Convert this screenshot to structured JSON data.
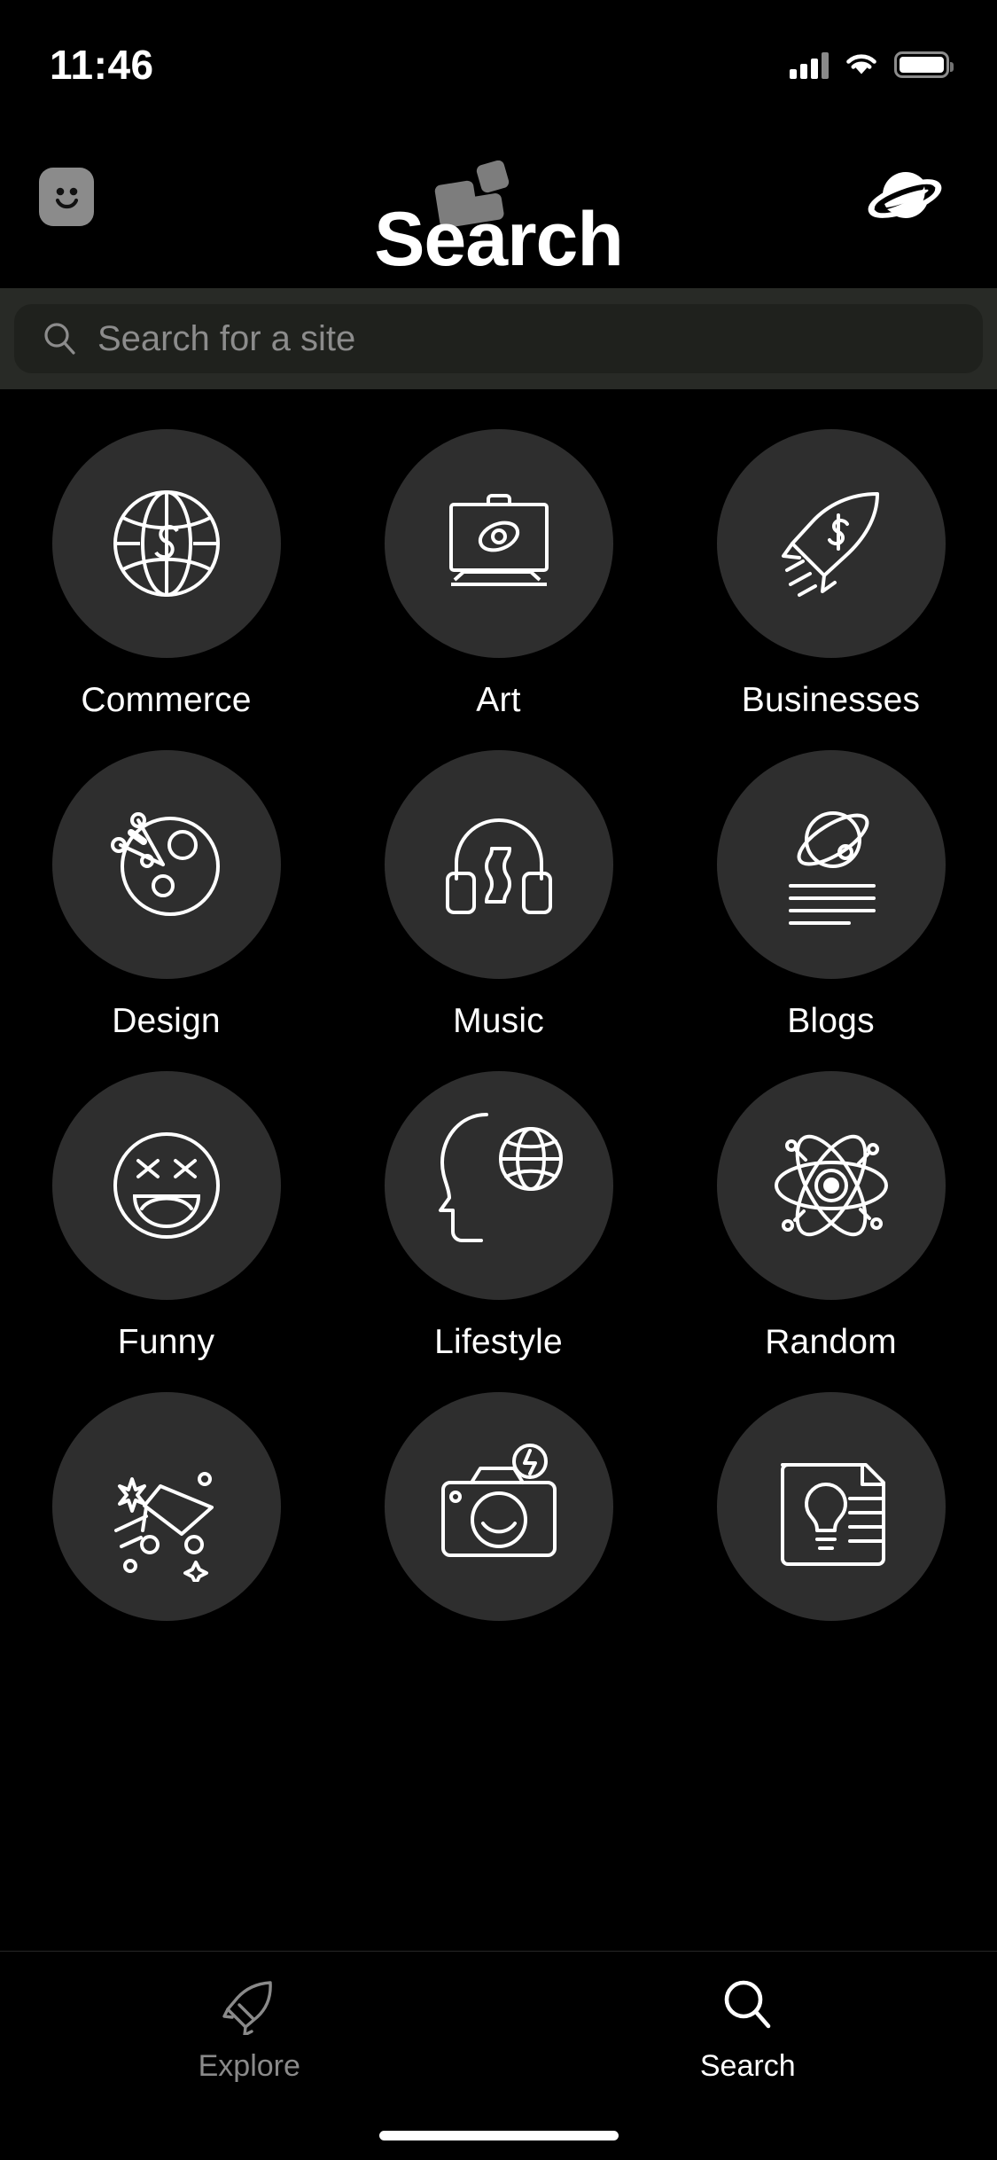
{
  "status_bar": {
    "time": "11:46",
    "icons": [
      "cellular-signal-icon",
      "wifi-icon",
      "battery-icon"
    ]
  },
  "top_nav": {
    "avatar": {
      "name": "avatar-smiley",
      "icon": "smiley-face-icon"
    },
    "center": {
      "name": "tiles-button",
      "icon": "stacked-tiles-icon"
    },
    "right": {
      "name": "planet-button",
      "icon": "saturn-planet-icon"
    }
  },
  "header": {
    "title": "Search"
  },
  "search": {
    "placeholder": "Search for a site",
    "value": "",
    "icon": "search-icon"
  },
  "categories": [
    {
      "label": "Commerce",
      "icon": "globe-dollar-icon"
    },
    {
      "label": "Art",
      "icon": "canvas-easel-icon"
    },
    {
      "label": "Businesses",
      "icon": "rocket-dollar-icon"
    },
    {
      "label": "Design",
      "icon": "planet-compass-icon"
    },
    {
      "label": "Music",
      "icon": "headphones-icon"
    },
    {
      "label": "Blogs",
      "icon": "atom-lines-icon"
    },
    {
      "label": "Funny",
      "icon": "laughing-face-icon"
    },
    {
      "label": "Lifestyle",
      "icon": "head-globe-icon"
    },
    {
      "label": "Random",
      "icon": "atom-icon"
    },
    {
      "label": "",
      "icon": "shooting-cart-icon"
    },
    {
      "label": "",
      "icon": "camera-icon"
    },
    {
      "label": "",
      "icon": "lightbulb-document-icon"
    }
  ],
  "tab_bar": {
    "tabs": [
      {
        "label": "Explore",
        "icon": "rocket-icon",
        "active": false
      },
      {
        "label": "Search",
        "icon": "search-icon",
        "active": true
      }
    ]
  },
  "colors": {
    "background": "#000000",
    "circle": "#2e2e2e",
    "search_band": "#282a26",
    "search_field": "#1f211d",
    "accent_text": "#ffffff",
    "muted_text": "#8a8a8a"
  }
}
